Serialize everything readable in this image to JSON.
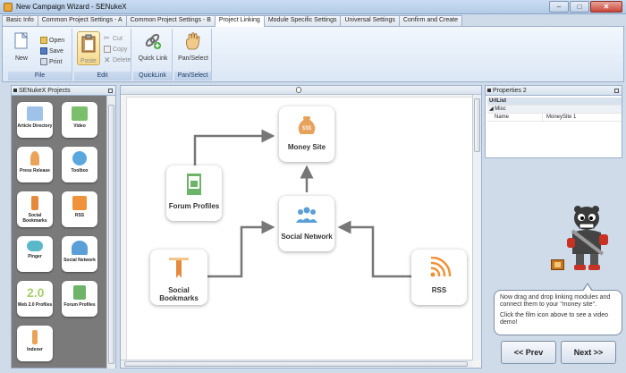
{
  "window": {
    "title": "New Campaign Wizard - SENukeX"
  },
  "tabs": [
    {
      "label": "Basic Info"
    },
    {
      "label": "Common Project Settings - A"
    },
    {
      "label": "Common Project Settings - B"
    },
    {
      "label": "Project Linking",
      "active": true
    },
    {
      "label": "Module Specific Settings"
    },
    {
      "label": "Universal Settings"
    },
    {
      "label": "Confirm and Create"
    }
  ],
  "ribbon": {
    "file": {
      "label": "File",
      "new": "New",
      "open": "Open",
      "save": "Save",
      "print": "Print"
    },
    "edit": {
      "label": "Edit",
      "paste": "Paste",
      "cut": "Cut",
      "copy": "Copy",
      "delete": "Delete"
    },
    "quicklink": {
      "label": "QuickLink",
      "button": "Quick Link"
    },
    "panselect": {
      "label": "Pan/Select",
      "button": "Pan/Select"
    }
  },
  "left_panel": {
    "title": "SENukeX Projects",
    "modules": [
      {
        "label": "Article Directory",
        "icon": "article-directory-icon",
        "color": "#9fc3e8"
      },
      {
        "label": "Video",
        "icon": "video-icon",
        "color": "#7cbf6b"
      },
      {
        "label": "Press Release",
        "icon": "press-release-icon",
        "color": "#e9a45a"
      },
      {
        "label": "Toolbox",
        "icon": "toolbox-icon",
        "color": "#5aa7e0"
      },
      {
        "label": "Social Bookmarks",
        "icon": "social-bookmarks-icon",
        "color": "#e58a3c"
      },
      {
        "label": "RSS",
        "icon": "rss-icon",
        "color": "#f0923a"
      },
      {
        "label": "Pinger",
        "icon": "pinger-icon",
        "color": "#5bb8c9"
      },
      {
        "label": "Social Network",
        "icon": "social-network-icon",
        "color": "#5b9fd8"
      },
      {
        "label": "Web 2.0 Profiles",
        "icon": "web20-profiles-icon",
        "color": "#a8cf6d"
      },
      {
        "label": "Forum Profiles",
        "icon": "forum-profiles-icon",
        "color": "#6db36a"
      },
      {
        "label": "Indexer",
        "icon": "indexer-icon",
        "color": "#e9a45a"
      }
    ]
  },
  "canvas": {
    "nodes": [
      {
        "label": "Money Site",
        "icon": "money-bag-icon",
        "color": "#e6a25a"
      },
      {
        "label": "Forum Profiles",
        "icon": "forum-profiles-icon",
        "color": "#6db36a"
      },
      {
        "label": "Social Network",
        "icon": "social-network-icon",
        "color": "#5b9fd8"
      },
      {
        "label": "Social Bookmarks",
        "icon": "social-bookmarks-icon",
        "color": "#e58a3c"
      },
      {
        "label": "RSS",
        "icon": "rss-icon",
        "color": "#f0923a"
      }
    ]
  },
  "properties": {
    "title": "Properties 2",
    "section": "UrlList",
    "category": "Misc",
    "rows": [
      {
        "name": "Name",
        "value": "MoneySite 1"
      }
    ]
  },
  "help": {
    "line1": "Now drag and drop linking modules and connect them to your \"money site\".",
    "line2": "Click the film icon above to see a video demo!"
  },
  "nav": {
    "prev": "<< Prev",
    "next": "Next >>"
  }
}
